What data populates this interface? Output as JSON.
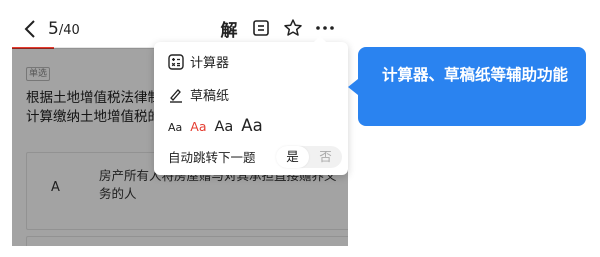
{
  "header": {
    "counter_current": "5",
    "counter_total": "/40",
    "jie_label": "解",
    "progress": 0.125
  },
  "question": {
    "type_badge": "单选",
    "text": "根据土地增值税法律制度的规定，下列各项中，需要计算缴纳土地增值税的是"
  },
  "options": [
    {
      "letter": "A",
      "text": "房产所有人将房屋赠与对其承担直接赡养义务的人"
    }
  ],
  "menu": {
    "calculator_label": "计算器",
    "draft_label": "草稿纸",
    "font_sizes": [
      "Aa",
      "Aa",
      "Aa",
      "Aa"
    ],
    "selected_font_index": 1,
    "auto_next_label": "自动跳转下一题",
    "toggle_yes": "是",
    "toggle_no": "否"
  },
  "callout": {
    "text": "计算器、草稿纸等辅助功能"
  },
  "colors": {
    "accent_red": "#e53b2f",
    "callout_blue": "#2a83f0"
  }
}
